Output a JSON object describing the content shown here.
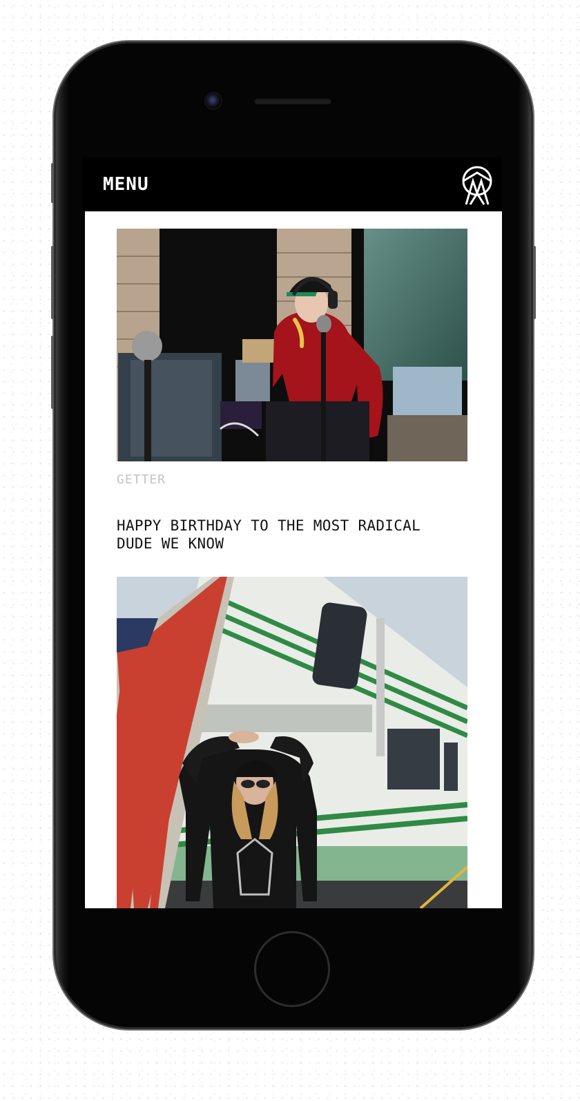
{
  "header": {
    "menu_label": "MENU",
    "logo_icon": "owsla-logo-icon"
  },
  "feed": {
    "items": [
      {
        "image_alt": "Man in red velvet hoodie, cap and headphones eating a banana behind a microphone",
        "caption": "GETTER"
      },
      {
        "headline": "HAPPY BIRTHDAY TO THE MOST RADICAL DUDE WE KNOW",
        "image_alt": "Woman in leather jacket, cap and sunglasses posing in front of a green striped RV with an American flag"
      }
    ]
  },
  "colors": {
    "phone_body": "#050505",
    "header_bg": "#000000",
    "caption_gray": "#c4c4c4",
    "headline": "#111111"
  }
}
